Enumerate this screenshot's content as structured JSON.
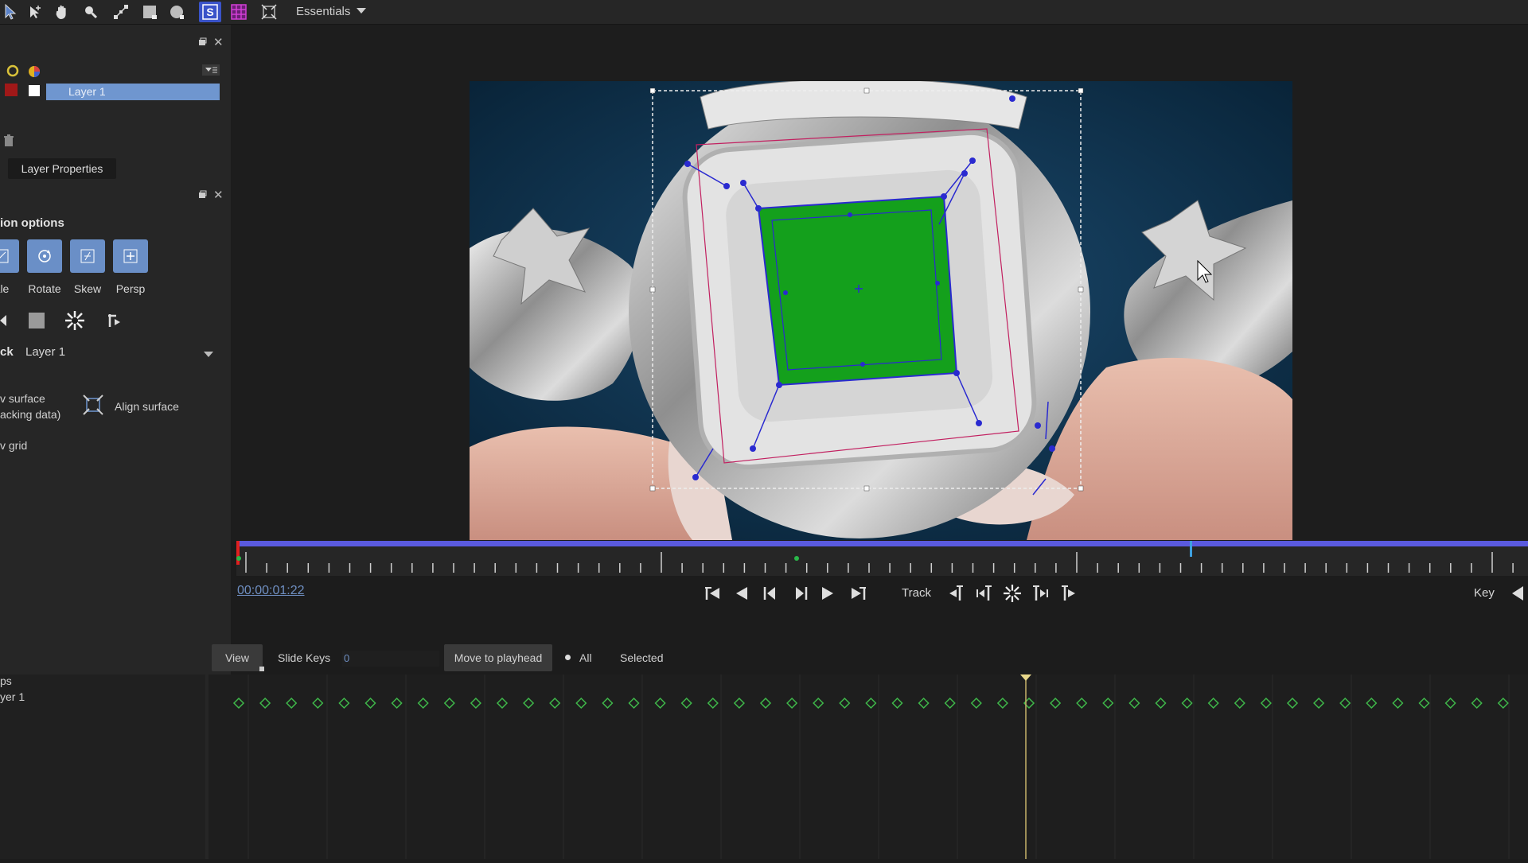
{
  "toolbar": {
    "workspace_label": "Essentials",
    "tools": [
      "arrow-select-icon",
      "node-select-icon",
      "hand-pan-icon",
      "zoom-icon",
      "transform-icon",
      "rectangle-icon",
      "circle-icon",
      "surface-s-icon",
      "grid-icon",
      "corner-pin-icon"
    ]
  },
  "layers_panel": {
    "layer_name": "Layer 1",
    "layer_properties_label": "Layer Properties"
  },
  "transform_panel": {
    "options_heading": "ion options",
    "buttons": [
      {
        "label": "ale"
      },
      {
        "label": "Rotate"
      },
      {
        "label": "Skew"
      },
      {
        "label": "Persp"
      }
    ],
    "track_label": "ck",
    "track_layer": "Layer 1",
    "show_surface_label_1": "v surface",
    "show_surface_label_2": "acking data)",
    "align_surface_label": "Align surface",
    "show_grid_label": "v grid"
  },
  "transport": {
    "timecode": "00:00:01:22",
    "track_label": "Track",
    "key_label": "Key"
  },
  "keys_panel": {
    "view_label": "View",
    "slide_keys_label": "Slide Keys",
    "slide_keys_value": "0",
    "move_to_playhead_label": "Move to  playhead",
    "all_label": "All",
    "selected_label": "Selected",
    "list_item_1": "ps",
    "list_item_2": "yer 1"
  },
  "colors": {
    "accent": "#6f96cf",
    "tracking_green": "#14a01c",
    "keyframe_green": "#3fb84a",
    "playhead": "#c7b36a",
    "timeline_bar": "#5a5adf"
  }
}
